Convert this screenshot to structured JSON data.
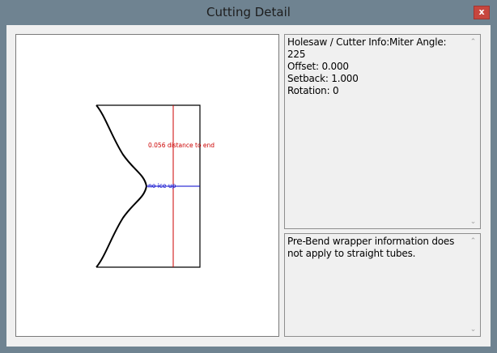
{
  "window": {
    "title": "Cutting Detail",
    "close_glyph": "x"
  },
  "drawing": {
    "distance_label": "0.056 distance to end",
    "marker_label": "no ice up"
  },
  "info_box": {
    "text": "Holesaw / Cutter Info:Miter Angle: 225\nOffset: 0.000\nSetback: 1.000\nRotation: 0"
  },
  "wrapper_box": {
    "text": "Pre-Bend wrapper information does not apply to straight tubes."
  },
  "scrollbar": {
    "up_glyph": "⌃",
    "down_glyph": "⌄"
  },
  "colors": {
    "title_bar": "#6f8391",
    "close_button": "#c7463e",
    "distance_line": "#cc0000",
    "marker_line": "#0000cc"
  }
}
